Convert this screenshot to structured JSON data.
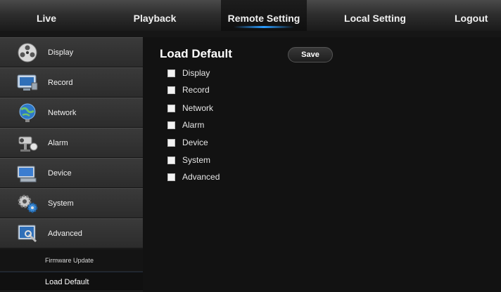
{
  "topnav": {
    "tabs": [
      {
        "label": "Live"
      },
      {
        "label": "Playback"
      },
      {
        "label": "Remote Setting"
      },
      {
        "label": "Local Setting"
      },
      {
        "label": "Logout"
      }
    ],
    "active_tab": "Remote Setting",
    "accent_color": "#2a9cff"
  },
  "sidebar": {
    "items": [
      {
        "label": "Display",
        "icon": "display-icon"
      },
      {
        "label": "Record",
        "icon": "record-icon"
      },
      {
        "label": "Network",
        "icon": "network-icon"
      },
      {
        "label": "Alarm",
        "icon": "alarm-icon"
      },
      {
        "label": "Device",
        "icon": "device-icon"
      },
      {
        "label": "System",
        "icon": "system-icon"
      },
      {
        "label": "Advanced",
        "icon": "advanced-icon"
      }
    ],
    "subitems": [
      {
        "label": "Firmware Update"
      },
      {
        "label": "Load Default"
      }
    ],
    "active_subitem": "Load Default"
  },
  "main": {
    "title": "Load Default",
    "save_label": "Save",
    "options": [
      {
        "label": "Display",
        "checked": false
      },
      {
        "label": "Record",
        "checked": false
      },
      {
        "label": "Network",
        "checked": false
      },
      {
        "label": "Alarm",
        "checked": false
      },
      {
        "label": "Device",
        "checked": false
      },
      {
        "label": "System",
        "checked": false
      },
      {
        "label": "Advanced",
        "checked": false
      }
    ]
  }
}
